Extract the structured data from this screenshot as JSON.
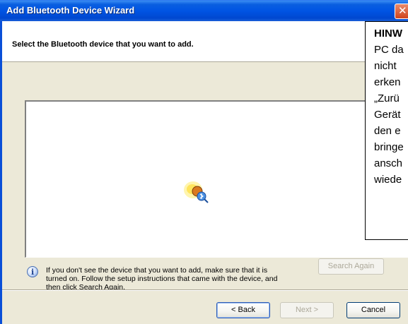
{
  "window": {
    "title": "Add Bluetooth Device Wizard",
    "close_glyph": "✕"
  },
  "header": {
    "heading": "Select the Bluetooth device that you want to add."
  },
  "device_panel": {
    "status_icon": "bluetooth-search-icon"
  },
  "info": {
    "icon": "info-icon",
    "icon_glyph": "i",
    "text": "If you don't see the device that you want to add, make sure that it is turned on. Follow the setup instructions that came with the device, and then click Search Again."
  },
  "buttons": {
    "search_again": "Search Again",
    "back": "< Back",
    "next": "Next >",
    "cancel": "Cancel"
  },
  "note": {
    "title": "HINW",
    "lines": [
      "PC da",
      "nicht",
      "erken",
      "„Zurü",
      "Gerät",
      "den e",
      "bringe",
      "ansch",
      "wiede"
    ]
  },
  "colors": {
    "titlebar": "#0054e3",
    "dialog_bg": "#ece9d8",
    "close_button": "#d0441c"
  }
}
